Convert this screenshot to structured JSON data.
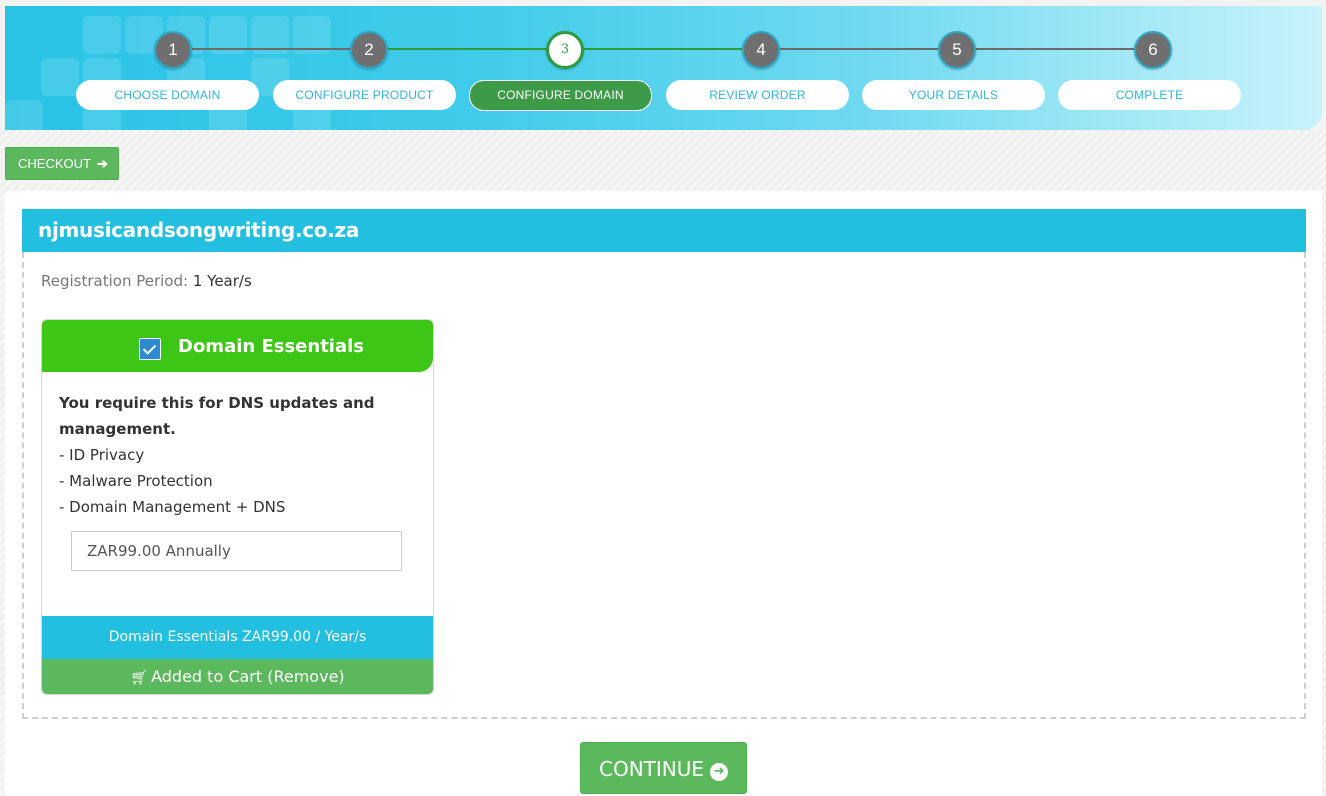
{
  "steps": [
    {
      "number": "1",
      "label": "CHOOSE DOMAIN"
    },
    {
      "number": "2",
      "label": "CONFIGURE PRODUCT"
    },
    {
      "number": "3",
      "label": "CONFIGURE DOMAIN"
    },
    {
      "number": "4",
      "label": "REVIEW ORDER"
    },
    {
      "number": "5",
      "label": "YOUR DETAILS"
    },
    {
      "number": "6",
      "label": "COMPLETE"
    }
  ],
  "active_step": 3,
  "checkout": {
    "label": "CHECKOUT",
    "icon": "arrow-right-icon"
  },
  "domain": {
    "name": "njmusicandsongwriting.co.za"
  },
  "registration": {
    "label": "Registration Period:",
    "value": "1 Year/s"
  },
  "addon": {
    "title": "Domain Essentials",
    "checked": true,
    "description_bold": "You require this for DNS updates and management.",
    "features": [
      "- ID Privacy",
      "- Malware Protection",
      "- Domain Management + DNS"
    ],
    "price_option": "ZAR99.00 Annually",
    "price_summary": "Domain Essentials ZAR99.00 / Year/s",
    "cart_status": "Added to Cart (Remove)",
    "cart_icon": "shopping-cart-icon"
  },
  "continue": {
    "label": "CONTINUE",
    "icon": "arrow-circle-right-icon"
  },
  "colors": {
    "header_start": "#29c3e6",
    "header_end": "#c8f3fb",
    "accent_blue": "#22bfe0",
    "success_green": "#5cb85c",
    "addon_green": "#3dc615",
    "active_step_green": "#3d9a46",
    "step_circle_gray": "#6f6f6f"
  }
}
